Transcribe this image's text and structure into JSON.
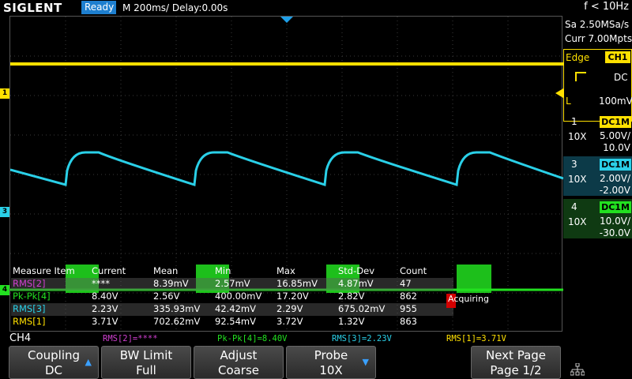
{
  "header": {
    "logo": "SIGLENT",
    "status": "Ready",
    "timebase": "M 200ms/  Delay:0.00s",
    "frequency": "f < 10Hz"
  },
  "acquisition": {
    "sample_rate": "Sa 2.50MSa/s",
    "memory": "Curr 7.00Mpts"
  },
  "trigger": {
    "mode": "Edge",
    "source": "CH1",
    "coupling": "DC",
    "level_label": "L",
    "level": "100mV"
  },
  "channels": [
    {
      "num": "1",
      "coupling": "DC1M",
      "probe": "10X",
      "scale": "5.00V/",
      "offset": "10.0V",
      "color": "#ffe000"
    },
    {
      "num": "3",
      "coupling": "DC1M",
      "probe": "10X",
      "scale": "2.00V/",
      "offset": "-2.00V",
      "color": "#2ad0e8"
    },
    {
      "num": "4",
      "coupling": "DC1M",
      "probe": "10X",
      "scale": "10.0V/",
      "offset": "-30.0V",
      "color": "#22e020"
    }
  ],
  "markers": {
    "ch1": "1",
    "ch3": "3",
    "ch4": "4"
  },
  "measure": {
    "headers": [
      "Measure Item",
      "Current",
      "Mean",
      "Min",
      "Max",
      "Std-Dev",
      "Count"
    ],
    "rows": [
      {
        "item": "RMS[2]",
        "color": "#d040d0",
        "values": [
          "****",
          "8.39mV",
          "2.57mV",
          "16.85mV",
          "4.87mV",
          "47"
        ]
      },
      {
        "item": "Pk-Pk[4]",
        "color": "#22e020",
        "values": [
          "8.40V",
          "2.56V",
          "400.00mV",
          "17.20V",
          "2.82V",
          "862"
        ]
      },
      {
        "item": "RMS[3]",
        "color": "#2ad0e8",
        "values": [
          "2.23V",
          "335.93mV",
          "42.42mV",
          "2.29V",
          "675.02mV",
          "955"
        ]
      },
      {
        "item": "RMS[1]",
        "color": "#ffe000",
        "values": [
          "3.71V",
          "702.62mV",
          "92.54mV",
          "3.72V",
          "1.32V",
          "863"
        ]
      }
    ],
    "acquiring": "Acquiring"
  },
  "summary": {
    "selected_channel": "CH4",
    "items": [
      {
        "text": "RMS[2]=****",
        "color": "#d040d0"
      },
      {
        "text": "Pk-Pk[4]=8.40V",
        "color": "#22e020"
      },
      {
        "text": "RMS[3]=2.23V",
        "color": "#2ad0e8"
      },
      {
        "text": "RMS[1]=3.71V",
        "color": "#ffe000"
      }
    ]
  },
  "softkeys": [
    {
      "line1": "Coupling",
      "line2": "DC"
    },
    {
      "line1": "BW Limit",
      "line2": "Full"
    },
    {
      "line1": "Adjust",
      "line2": "Coarse"
    },
    {
      "line1": "Probe",
      "line2": "10X"
    },
    {
      "line1": "Next Page",
      "line2": "Page 1/2"
    }
  ]
}
